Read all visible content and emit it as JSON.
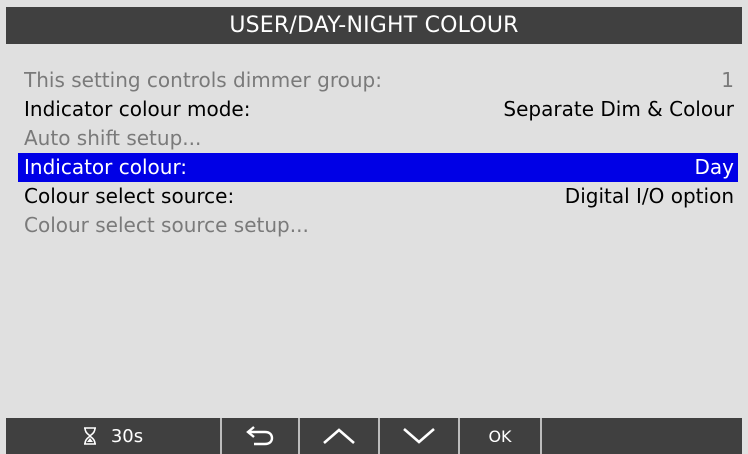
{
  "title": "USER/DAY-NIGHT COLOUR",
  "menu": {
    "items": [
      {
        "label": "This setting controls dimmer group:",
        "value": "1",
        "state": "disabled"
      },
      {
        "label": "Indicator colour mode:",
        "value": "Separate Dim & Colour",
        "state": "enabled"
      },
      {
        "label": "Auto shift setup...",
        "value": "",
        "state": "disabled"
      },
      {
        "label": "Indicator colour:",
        "value": "Day",
        "state": "selected"
      },
      {
        "label": "Colour select source:",
        "value": "Digital I/O option",
        "state": "enabled"
      },
      {
        "label": "Colour select source setup...",
        "value": "",
        "state": "disabled"
      }
    ]
  },
  "footer": {
    "timer_icon": "hourglass-icon",
    "timer_text": "30s",
    "back_icon": "back-arrow-icon",
    "up_icon": "chevron-up-icon",
    "down_icon": "chevron-down-icon",
    "ok_label": "OK"
  },
  "colors": {
    "background": "#e0e0e0",
    "bar": "#404040",
    "selection": "#0000e6",
    "disabled_text": "#7a7a7a"
  }
}
